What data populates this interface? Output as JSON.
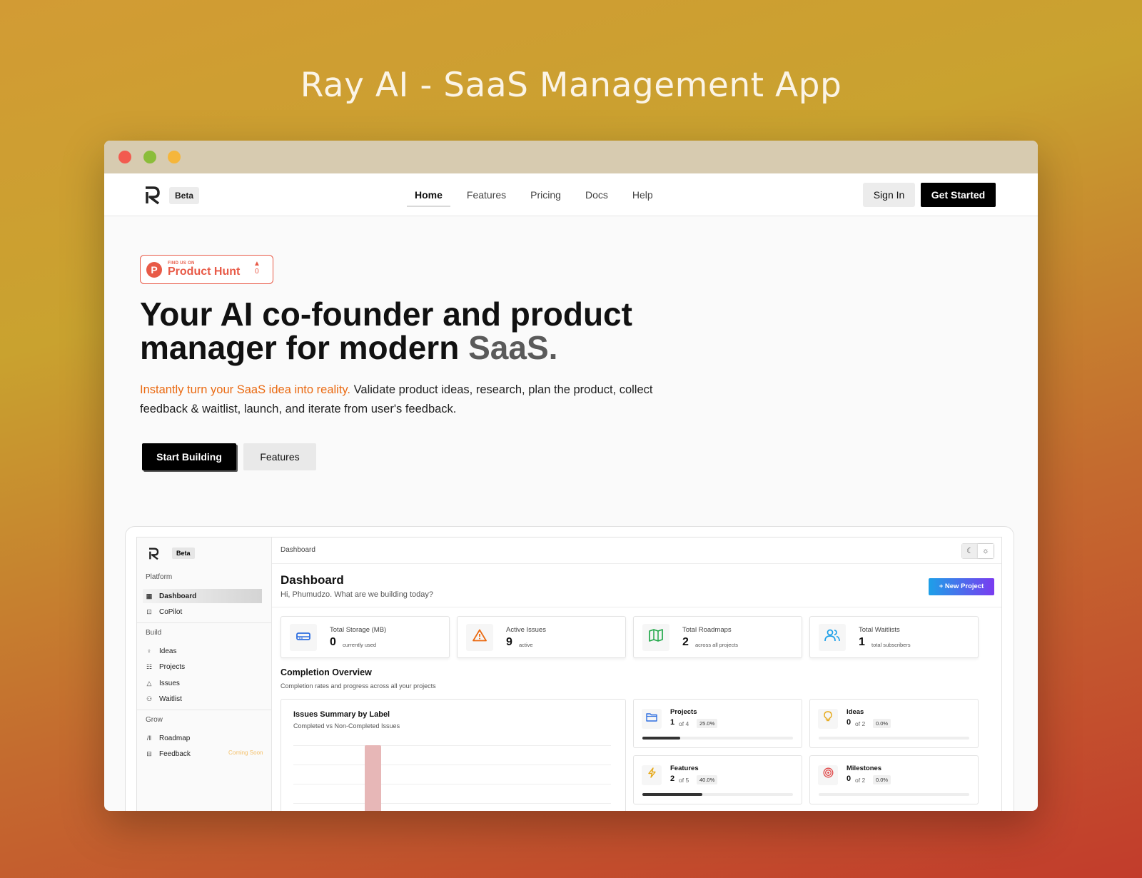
{
  "headline": "Ray AI  - SaaS Management App",
  "nav": {
    "beta": "Beta",
    "links": [
      "Home",
      "Features",
      "Pricing",
      "Docs",
      "Help"
    ],
    "sign_in": "Sign In",
    "get_started": "Get Started"
  },
  "product_hunt": {
    "small": "FIND US ON",
    "name": "Product Hunt",
    "votes": "0"
  },
  "hero": {
    "title_line1": "Your AI co-founder and product",
    "title_line2": "manager for modern ",
    "title_highlight": "SaaS.",
    "sub_accent": "Instantly turn your SaaS idea into reality.",
    "sub_rest": " Validate product ideas, research, plan the product, collect feedback & waitlist, launch, and iterate from user's feedback.",
    "start_building": "Start Building",
    "features": "Features"
  },
  "app": {
    "beta": "Beta",
    "sidebar": {
      "platform": "Platform",
      "dashboard": "Dashboard",
      "copilot": "CoPilot",
      "build": "Build",
      "ideas": "Ideas",
      "projects": "Projects",
      "issues": "Issues",
      "waitlist": "Waitlist",
      "grow": "Grow",
      "roadmap": "Roadmap",
      "feedback": "Feedback",
      "coming_soon": "Coming Soon"
    },
    "breadcrumb": "Dashboard",
    "title": "Dashboard",
    "subtitle": "Hi, Phumudzo. What are we building today?",
    "new_project": "+ New Project",
    "stats": [
      {
        "label": "Total Storage (MB)",
        "value": "0",
        "caption": "currently used",
        "icon": "storage-icon",
        "color": "#2f6fe0"
      },
      {
        "label": "Active Issues",
        "value": "9",
        "caption": "active",
        "icon": "warning-icon",
        "color": "#ea6a12"
      },
      {
        "label": "Total Roadmaps",
        "value": "2",
        "caption": "across all projects",
        "icon": "map-icon",
        "color": "#22a84a"
      },
      {
        "label": "Total Waitlists",
        "value": "1",
        "caption": "total subscribers",
        "icon": "users-icon",
        "color": "#1da0e8"
      }
    ],
    "completion_title": "Completion Overview",
    "completion_sub": "Completion rates and progress across all your projects",
    "issues_card": {
      "title": "Issues Summary by Label",
      "subtitle": "Completed vs Non-Completed Issues"
    },
    "mini_cards": [
      {
        "label": "Projects",
        "value": "1",
        "of": "of 4",
        "pct": "25.0%",
        "progress": 0.25,
        "icon": "folder-icon"
      },
      {
        "label": "Ideas",
        "value": "0",
        "of": "of 2",
        "pct": "0.0%",
        "progress": 0.0,
        "icon": "lightbulb-icon"
      },
      {
        "label": "Features",
        "value": "2",
        "of": "of 5",
        "pct": "40.0%",
        "progress": 0.4,
        "icon": "lightning-icon"
      },
      {
        "label": "Milestones",
        "value": "0",
        "of": "of 2",
        "pct": "0.0%",
        "progress": 0.0,
        "icon": "target-icon"
      }
    ]
  }
}
